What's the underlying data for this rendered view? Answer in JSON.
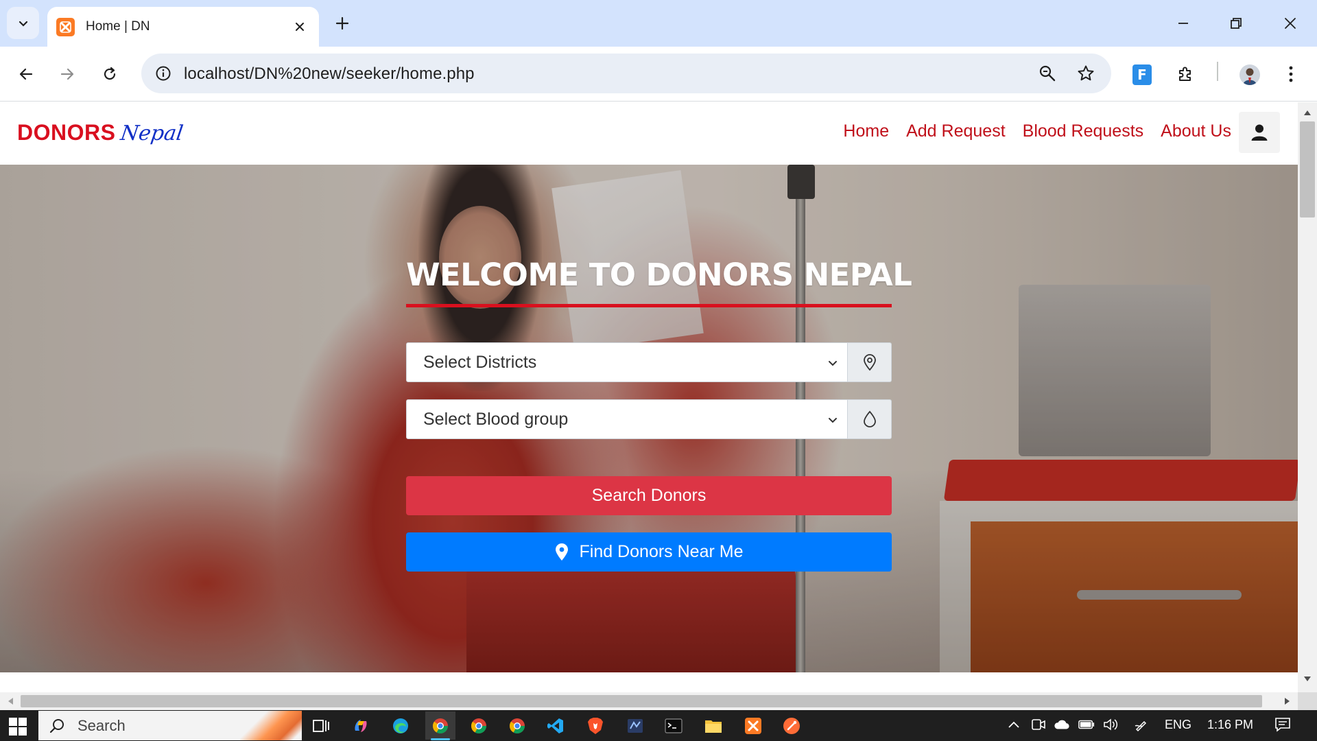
{
  "browser": {
    "tab": {
      "title": "Home | DN"
    },
    "url": "localhost/DN%20new/seeker/home.php"
  },
  "site": {
    "brand": {
      "main": "DONORS",
      "script": "Nepal"
    },
    "nav": [
      {
        "label": "Home"
      },
      {
        "label": "Add Request"
      },
      {
        "label": "Blood Requests"
      },
      {
        "label": "About Us"
      }
    ],
    "hero": {
      "title": "WELCOME TO DONORS NEPAL",
      "district_select": {
        "value": "Select Districts",
        "icon": "location-pin-outline-icon"
      },
      "blood_select": {
        "value": "Select Blood group",
        "icon": "blood-drop-icon"
      },
      "search_button": "Search Donors",
      "near_button": "Find Donors Near Me"
    },
    "colors": {
      "brand_red": "#d90f1f",
      "script_blue": "#1130c6",
      "search_btn": "#dc3545",
      "near_btn": "#007bff"
    }
  },
  "taskbar": {
    "search_placeholder": "Search",
    "language": "ENG",
    "time": "1:16 PM"
  }
}
